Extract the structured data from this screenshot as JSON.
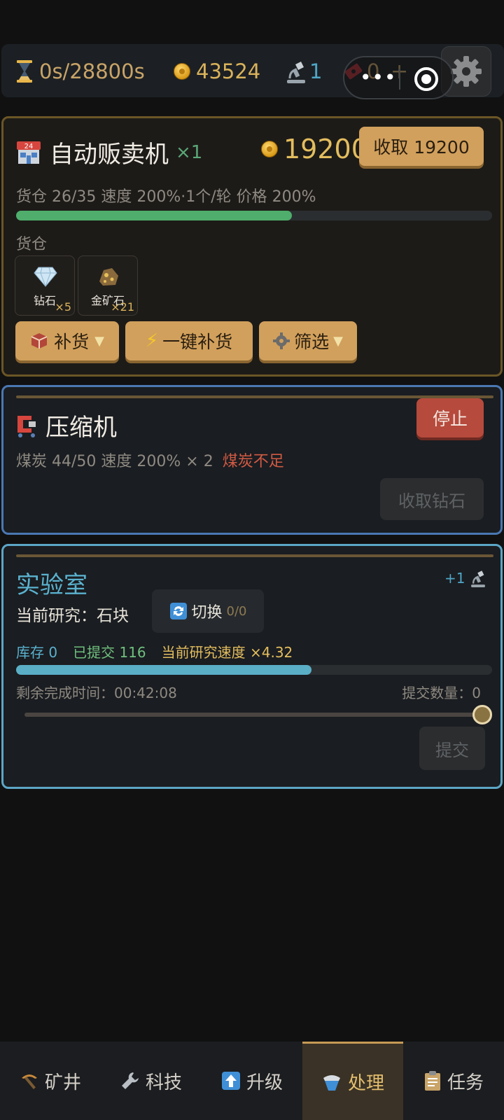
{
  "topbar": {
    "time": "0s/28800s",
    "coins": "43524",
    "science": "1",
    "tickets": "0",
    "plus": "+",
    "more_dots": "•••"
  },
  "vending": {
    "title": "自动贩卖机",
    "multiplier": "×1",
    "price": "19200",
    "collect_label": "收取 19200",
    "info": "货仓 26/35 速度 200%·1个/轮 价格 200%",
    "progress": 0.58,
    "storage_label": "货仓",
    "slots": [
      {
        "name": "钻石",
        "qty": "×5"
      },
      {
        "name": "金矿石",
        "qty": "×21"
      }
    ],
    "restock_label": "补货",
    "one_click_label": "一键补货",
    "filter_label": "筛选"
  },
  "compressor": {
    "title": "压缩机",
    "stop_label": "停止",
    "info": "煤炭 44/50 速度 200% × 2",
    "warning": "煤炭不足",
    "collect_label": "收取钻石"
  },
  "lab": {
    "title": "实验室",
    "badge": "+1",
    "current_label": "当前研究：石块",
    "switch_label": "切换",
    "switch_count": "0/0",
    "stock": "库存 0",
    "submitted": "已提交 116",
    "speed": "当前研究速度 ×4.32",
    "progress": 0.62,
    "remaining": "剩余完成时间：00:42:08",
    "submit_count": "提交数量：0",
    "slider_value": 1.0,
    "submit_label": "提交"
  },
  "nav": [
    {
      "label": "矿井"
    },
    {
      "label": "科技"
    },
    {
      "label": "升级"
    },
    {
      "label": "处理"
    },
    {
      "label": "任务"
    }
  ],
  "colors": {
    "accent_gold": "#d1a05c",
    "progress_green": "#4fae6c",
    "progress_blue": "#5aaec6",
    "warning_red": "#d05a44"
  }
}
